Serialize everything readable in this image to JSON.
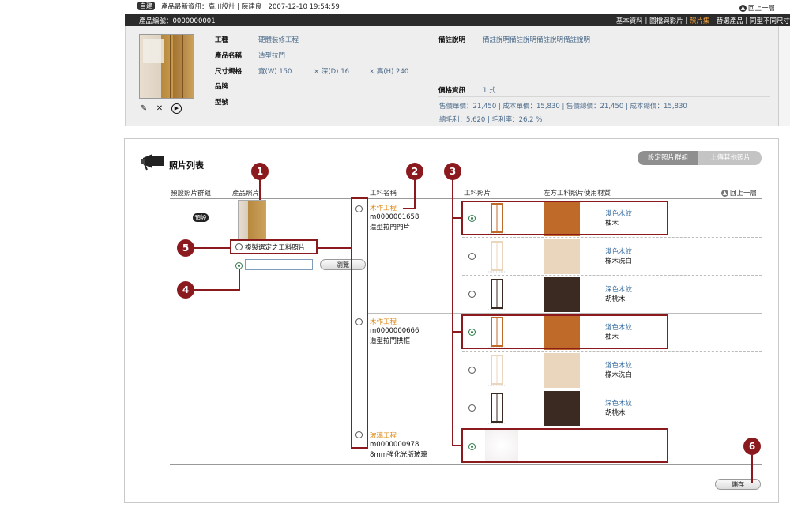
{
  "topbar": {
    "badge": "自建",
    "news": "產品最新資訊：高川設計 | 陳建良 | 2007-12-10  19:54:59",
    "back_top": "回上一層"
  },
  "header": {
    "product_code": "產品編號：0000000001",
    "nav": [
      "基本資料",
      "圖檔與影片",
      "照片集",
      "替選產品",
      "同型不同尺寸"
    ],
    "nav_active": "照片集",
    "nav_separator": "|"
  },
  "info": {
    "labels": {
      "category": "工種",
      "name": "產品名稱",
      "size": "尺寸規格",
      "brand": "品牌",
      "model": "型號",
      "note": "備註說明",
      "price": "價格資訊"
    },
    "category": "硬體裝修工程",
    "name": "造型拉門",
    "size_w": "寬(W)   150",
    "size_d": "× 深(D)  16",
    "size_h": "× 高(H)  240",
    "note": "備註說明備註說明備註說明備註說明",
    "price_unit": "1 式",
    "price_line1": "售價單價：21,450   |   成本單價：15,830   |   售價總價：21,450   |   成本總價：15,830",
    "price_line2": "總毛利：5,620   |   毛利率：26.2 %"
  },
  "section": {
    "title": "照片列表",
    "btn_group": "設定照片群組",
    "btn_upload": "上傳其他照片",
    "back": "回上一層"
  },
  "columns": {
    "default_group": "預設照片群組",
    "product_photo": "產品照片",
    "material_name": "工料名稱",
    "material_photo": "工料照片",
    "usage": "左方工料照片使用材質"
  },
  "left": {
    "default_badge": "預設",
    "copy_label": "複製選定之工料照片",
    "browse": "瀏覽",
    "upload_value": ""
  },
  "materials": [
    {
      "type": "木作工程",
      "code": "m0000001658",
      "name": "造型拉門門片"
    },
    {
      "type": "木作工程",
      "code": "m0000000666",
      "name": "造型拉門拱框"
    },
    {
      "type": "玻璃工程",
      "code": "m0000000978",
      "name": "8mm強化光版玻璃"
    }
  ],
  "variants": [
    {
      "tone": "淺色木紋",
      "wood": "柚木",
      "checked": true,
      "color": "#c06a2a"
    },
    {
      "tone": "淺色木紋",
      "wood": "橡木洗白",
      "checked": false,
      "color": "#ead6bd"
    },
    {
      "tone": "深色木紋",
      "wood": "胡桃木",
      "checked": false,
      "color": "#3a2a22"
    },
    {
      "tone": "淺色木紋",
      "wood": "柚木",
      "checked": true,
      "color": "#c06a2a"
    },
    {
      "tone": "淺色木紋",
      "wood": "橡木洗白",
      "checked": false,
      "color": "#ead6bd"
    },
    {
      "tone": "深色木紋",
      "wood": "胡桃木",
      "checked": false,
      "color": "#3a2a22"
    }
  ],
  "markers": [
    "1",
    "2",
    "3",
    "4",
    "5",
    "6"
  ],
  "save": "儲存",
  "colors": {
    "accent_red": "#8b1a1f",
    "orange": "#e08a1a",
    "nav_active": "#f2a13a"
  }
}
